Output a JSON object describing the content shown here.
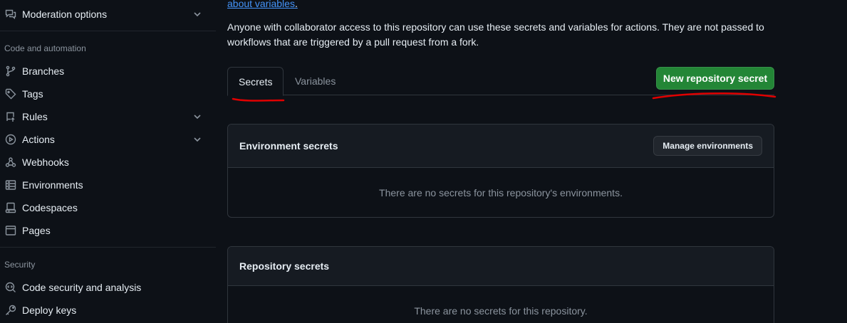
{
  "sidebar": {
    "top_item": {
      "label": "Moderation options",
      "icon": "comment-discussion-icon"
    },
    "section_code": {
      "heading": "Code and automation",
      "items": [
        {
          "label": "Branches",
          "icon": "git-branch-icon"
        },
        {
          "label": "Tags",
          "icon": "tag-icon"
        },
        {
          "label": "Rules",
          "icon": "repo-push-icon"
        },
        {
          "label": "Actions",
          "icon": "play-icon"
        },
        {
          "label": "Webhooks",
          "icon": "webhook-icon"
        },
        {
          "label": "Environments",
          "icon": "server-icon"
        },
        {
          "label": "Codespaces",
          "icon": "codespaces-icon"
        },
        {
          "label": "Pages",
          "icon": "browser-icon"
        }
      ]
    },
    "section_security": {
      "heading": "Security",
      "items": [
        {
          "label": "Code security and analysis",
          "icon": "codescan-icon"
        },
        {
          "label": "Deploy keys",
          "icon": "key-icon"
        }
      ]
    }
  },
  "main": {
    "link_text": "about variables",
    "link_trail": ".",
    "description": "Anyone with collaborator access to this repository can use these secrets and variables for actions. They are not passed to workflows that are triggered by a pull request from a fork.",
    "tabs": [
      {
        "label": "Secrets",
        "active": true
      },
      {
        "label": "Variables",
        "active": false
      }
    ],
    "new_secret_button": "New repository secret",
    "environment_box": {
      "title": "Environment secrets",
      "button": "Manage environments",
      "empty": "There are no secrets for this repository's environments."
    },
    "repository_box": {
      "title": "Repository secrets",
      "empty": "There are no secrets for this repository."
    }
  },
  "colors": {
    "background": "#0d1117",
    "primary_button": "#238636",
    "link": "#4493f8",
    "annotation": "#e00000"
  }
}
